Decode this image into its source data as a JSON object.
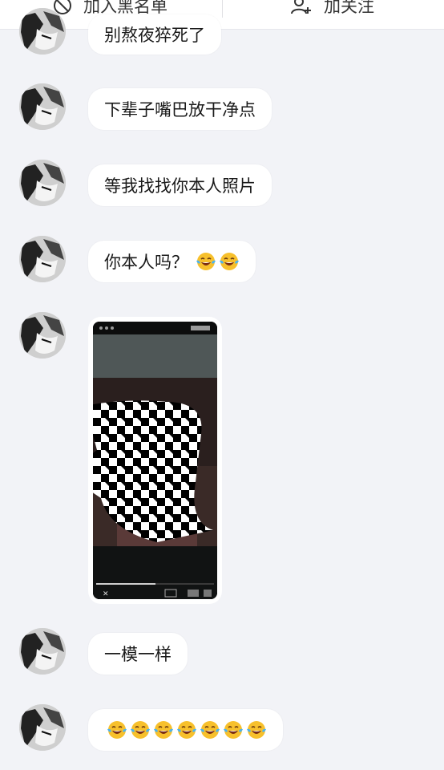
{
  "header": {
    "block_label": "加入黑名单",
    "follow_label": "加关注"
  },
  "messages": [
    {
      "text": "别熬夜猝死了"
    },
    {
      "text": "下辈子嘴巴放干净点"
    },
    {
      "text": "等我找找你本人照片"
    },
    {
      "text": "你本人吗？"
    },
    {
      "text": "一模一样"
    }
  ],
  "emoji": {
    "name": "tears-of-joy-icon",
    "count_msg4": 2,
    "count_last": 7
  },
  "colors": {
    "background": "#f2f3f7",
    "bubble": "#ffffff",
    "text": "#1a1a1a"
  }
}
